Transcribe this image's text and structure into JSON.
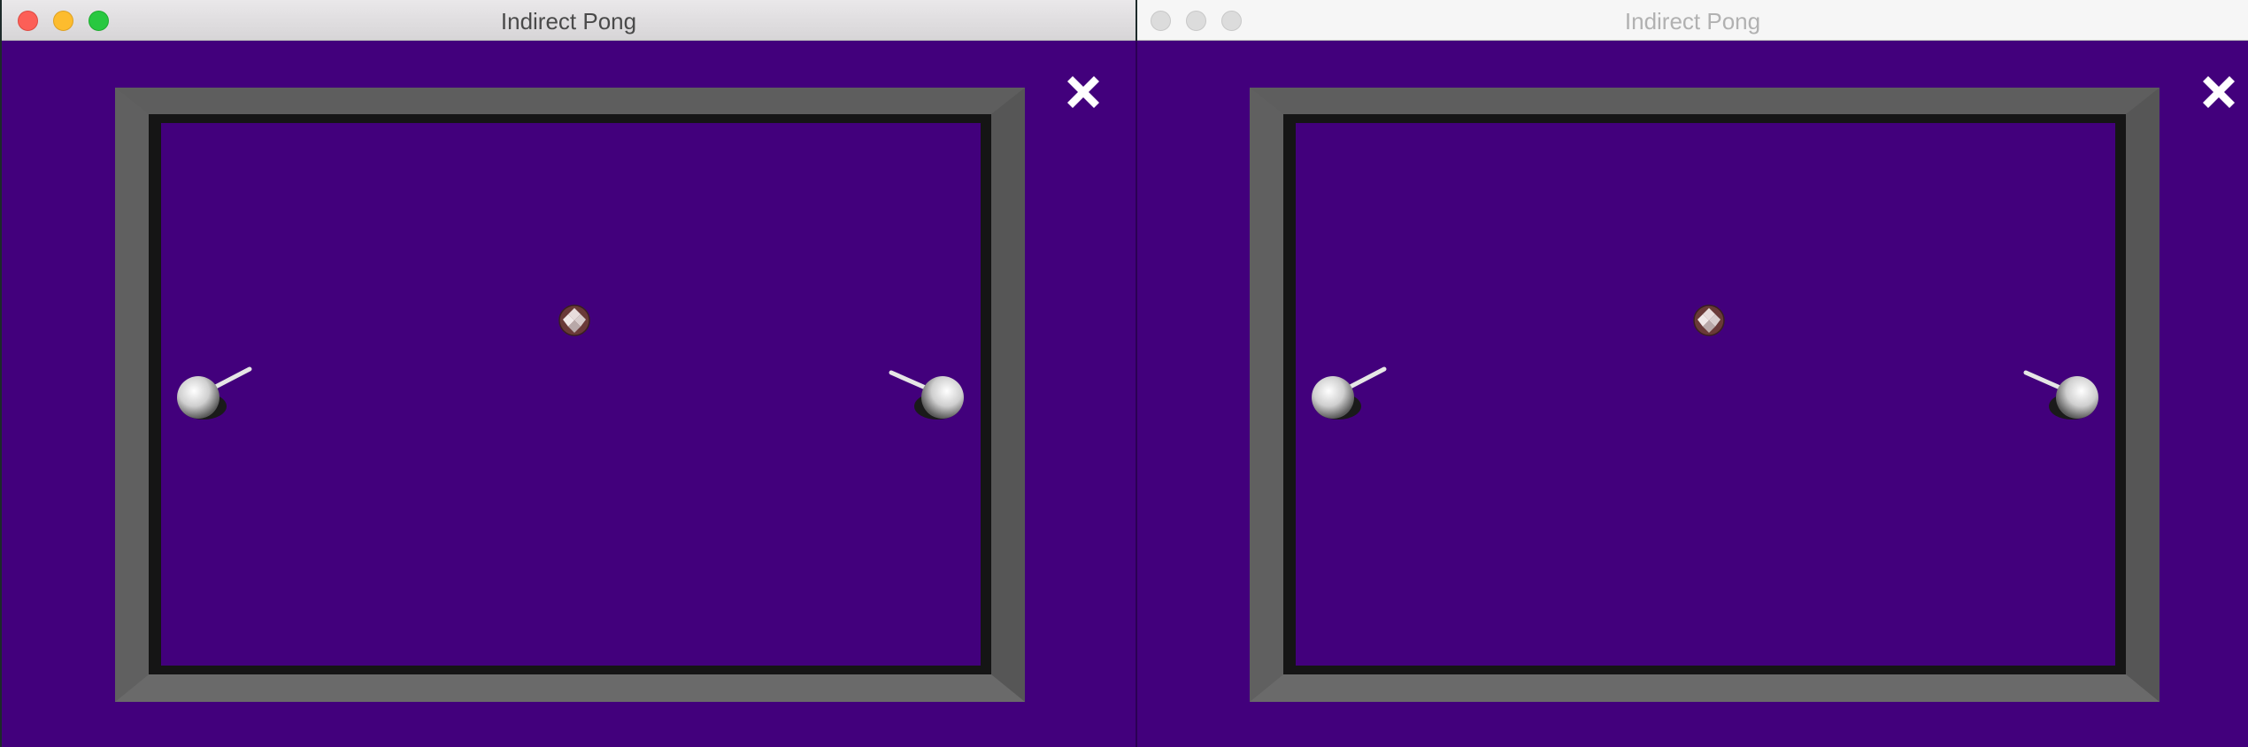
{
  "left_window": {
    "title": "Indirect Pong",
    "active": true,
    "traffic_lights": {
      "close": "#fc5f57",
      "minimize": "#fdbc2e",
      "zoom": "#28c840"
    }
  },
  "right_window": {
    "title": "Indirect Pong",
    "active": false,
    "traffic_lights": {
      "close": "#dcdcdc",
      "minimize": "#dcdcdc",
      "zoom": "#dcdcdc"
    }
  },
  "game": {
    "background_color": "#42007c",
    "frame_color": "#646464",
    "close_icon": "close-x-icon",
    "ball_icon": "soccer-ball-icon",
    "paddle_icon": "ball-paddle-icon"
  }
}
